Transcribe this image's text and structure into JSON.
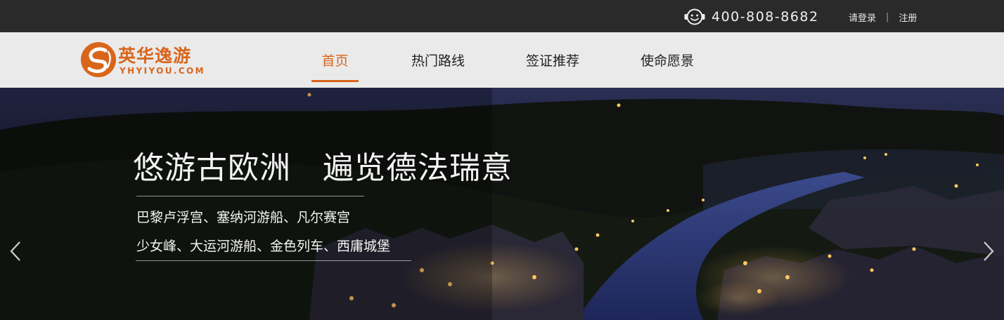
{
  "topbar": {
    "phone_icon": "headset-smiley-icon",
    "phone_number": "400-808-8682",
    "login_label": "请登录",
    "separator": "|",
    "register_label": "注册"
  },
  "brand": {
    "name_cn": "英华逸游",
    "name_en": "YHYIYOU.COM",
    "color": "#d9651b"
  },
  "nav": {
    "items": [
      {
        "label": "首页",
        "active": true
      },
      {
        "label": "热门路线",
        "active": false
      },
      {
        "label": "签证推荐",
        "active": false
      },
      {
        "label": "使命愿景",
        "active": false
      }
    ]
  },
  "hero": {
    "title": "悠游古欧洲　遍览德法瑞意",
    "line1": "巴黎卢浮宫、塞纳河游船、凡尔赛宫",
    "line2": "少女峰、大运河游船、金色列车、西庸城堡",
    "prev_icon": "chevron-left-icon",
    "next_icon": "chevron-right-icon"
  }
}
